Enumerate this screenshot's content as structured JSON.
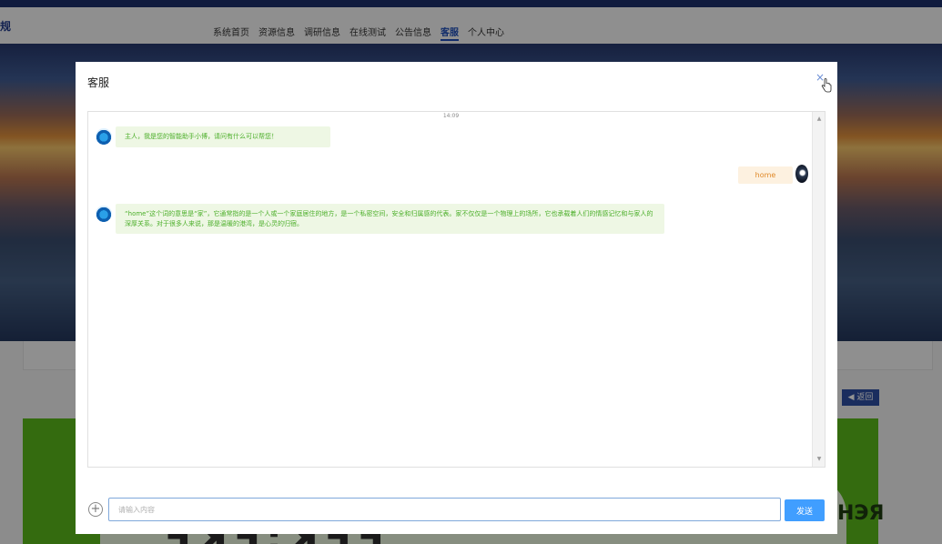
{
  "navbar": {
    "brand": "规",
    "links": [
      {
        "label": "系统首页",
        "active": false
      },
      {
        "label": "资源信息",
        "active": false
      },
      {
        "label": "调研信息",
        "active": false
      },
      {
        "label": "在线测试",
        "active": false
      },
      {
        "label": "公告信息",
        "active": false
      },
      {
        "label": "客服",
        "active": true
      },
      {
        "label": "个人中心",
        "active": false
      }
    ]
  },
  "page": {
    "return_label": "◀ 返回",
    "big_text": "ꟻꓘꟻ:ꓘꟻꟻ",
    "side_text": "НЭЯ"
  },
  "dialog": {
    "title": "客服",
    "close_symbol": "×",
    "timestamp": "14:09",
    "messages": [
      {
        "from": "bot",
        "text": "主人，我是您的智能助手小博，请问有什么可以帮您！"
      },
      {
        "from": "user",
        "text": "home"
      },
      {
        "from": "bot",
        "text": "“home”这个词的意思是“家”，它通常指的是一个人或一个家庭居住的地方，是一个私密空间，安全和归属感的代表。家不仅仅是一个物理上的场所，它也承载着人们的情感记忆和与家人的深厚关系。对于很多人来说，那是温暖的港湾，是心灵的归宿。"
      }
    ],
    "input_placeholder": "请输入内容",
    "input_value": "",
    "send_label": "发送",
    "plus_symbol": "+"
  },
  "colors": {
    "nav_active": "#1f4fb8",
    "send_button": "#409eff",
    "bot_bubble_bg": "#eef7e4",
    "bot_text": "#4caf2a",
    "user_bubble_bg": "#fdf1e0",
    "user_text": "#e08a2a"
  }
}
